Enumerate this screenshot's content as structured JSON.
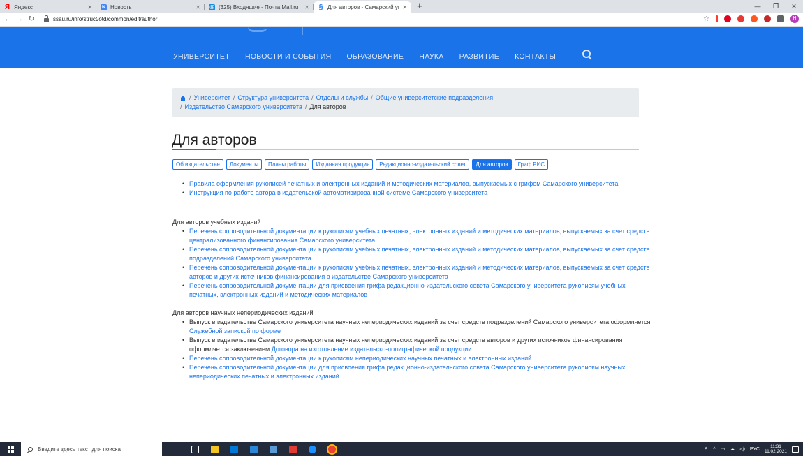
{
  "browser": {
    "tabs": [
      {
        "title": "Яндекс",
        "favicon": "yandex-icon",
        "color": "#ff0000",
        "glyph": "Я"
      },
      {
        "title": "Новость",
        "favicon": "news-icon",
        "color": "#4285f4",
        "glyph": "N"
      },
      {
        "title": "(325) Входящие - Почта Mail.ru",
        "favicon": "mail-icon",
        "color": "#168de2",
        "glyph": "@"
      },
      {
        "title": "Для авторов - Самарский униве",
        "favicon": "ssau-icon",
        "color": "#1a73e8",
        "glyph": "S"
      }
    ],
    "url": "ssau.ru/info/struct/otd/common/edit/author"
  },
  "nav": {
    "items": [
      "УНИВЕРСИТЕТ",
      "НОВОСТИ И СОБЫТИЯ",
      "ОБРАЗОВАНИЕ",
      "НАУКА",
      "РАЗВИТИЕ",
      "КОНТАКТЫ"
    ]
  },
  "breadcrumb": {
    "links": [
      "Университет",
      "Структура университета",
      "Отделы и службы",
      "Общие университетские подразделения",
      "Издательство Самарского университета"
    ],
    "current": "Для авторов"
  },
  "page": {
    "title": "Для авторов",
    "subtabs": [
      "Об издательстве",
      "Документы",
      "Планы работы",
      "Изданная продукция",
      "Редакционно-издательский совет",
      "Для авторов",
      "Гриф РИС"
    ],
    "active_subtab": "Для авторов"
  },
  "content": {
    "top_links": [
      "Правила оформления рукописей печатных и электронных изданий и методических материалов, выпускаемых с грифом Самарского университета",
      "Инструкция по работе автора в издательской автоматизированной системе Самарского университета"
    ],
    "section1_title": "Для авторов учебных изданий",
    "section1_links": [
      "Перечень сопроводительной документации к рукописям учебных печатных, электронных изданий и методических материалов, выпускаемых за счет средств централизованного финансирования Самарского университета",
      "Перечень сопроводительной документации к рукописям учебных печатных, электронных изданий и методических материалов, выпускаемых за счет средств подразделений Самарского университета",
      "Перечень сопроводительной документации к рукописям учебных печатных, электронных изданий и методических материалов, выпускаемых за счет средств авторов и других источников финансирования в издательстве Самарского университета",
      "Перечень сопроводительной документации для присвоения грифа редакционно-издательского совета Самарского университета рукописям учебных печатных, электронных изданий и методических материалов"
    ],
    "section2_title": "Для авторов научных непериодических изданий",
    "section2_item1_text": "Выпуск в издательстве Самарского университета научных непериодических изданий за счет средств подразделений Самарского университета оформляется ",
    "section2_item1_link": "Служебной запиской по форме",
    "section2_item2_text": "Выпуск в издательстве Самарского университета научных непериодических изданий за счет средств авторов и других источников финансирования оформляется заключением ",
    "section2_item2_link": "Договора на изготовление издательско-полиграфической продукции",
    "section2_links": [
      "Перечень сопроводительной документации к рукописям непериодических научных печатных и электронных изданий",
      "Перечень сопроводительной документации для присвоения грифа редакционно-издательского совета Самарского университета рукописям научных непериодических печатных и электронных изданий"
    ]
  },
  "taskbar": {
    "search_placeholder": "Введите здесь текст для поиска",
    "lang": "РУС",
    "time": "11:31",
    "date": "11.02.2021"
  }
}
